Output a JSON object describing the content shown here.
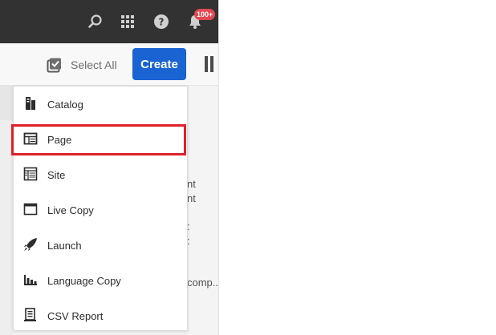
{
  "topbar": {
    "icons": [
      "search-icon",
      "apps-grid-icon",
      "help-icon",
      "notification-bell-icon"
    ],
    "notification_count": "100+"
  },
  "actionbar": {
    "select_all_label": "Select All",
    "create_label": "Create"
  },
  "background_text": [
    "nt",
    "nt",
    ":",
    ":",
    "comp.."
  ],
  "menu": {
    "items": [
      {
        "label": "Catalog",
        "icon": "catalog-icon"
      },
      {
        "label": "Page",
        "icon": "page-icon"
      },
      {
        "label": "Site",
        "icon": "site-icon"
      },
      {
        "label": "Live Copy",
        "icon": "live-copy-icon"
      },
      {
        "label": "Launch",
        "icon": "launch-icon"
      },
      {
        "label": "Language Copy",
        "icon": "language-copy-icon"
      },
      {
        "label": "CSV Report",
        "icon": "csv-report-icon"
      }
    ]
  },
  "colors": {
    "topbar": "#323232",
    "accent": "#1a63d3",
    "badge": "#e34850",
    "highlight": "#e0202a"
  }
}
